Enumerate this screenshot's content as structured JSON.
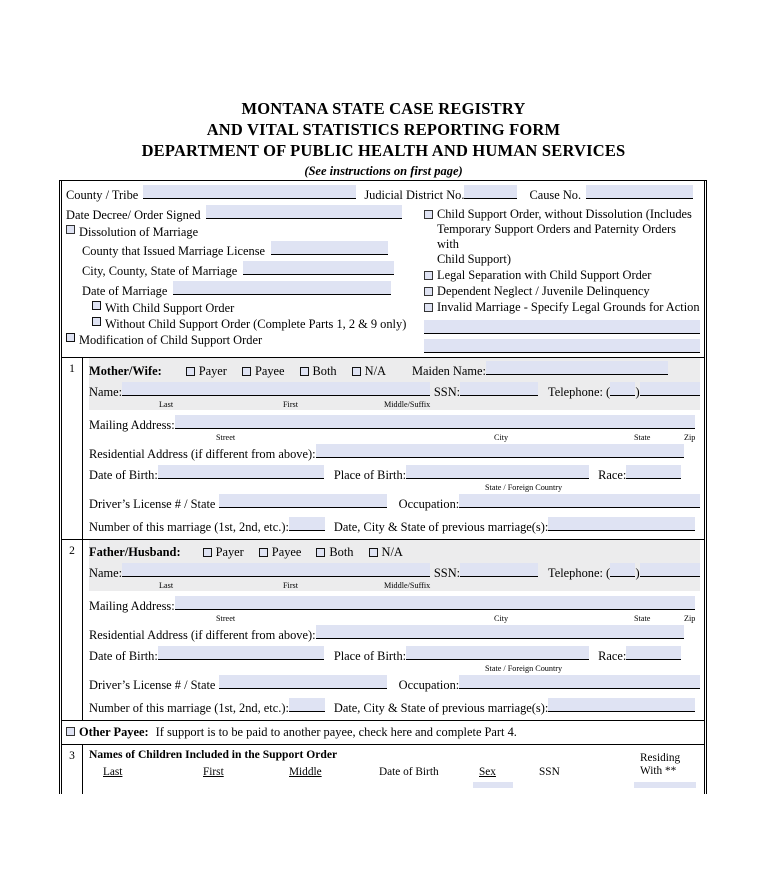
{
  "title": {
    "line1": "MONTANA STATE CASE REGISTRY",
    "line2": "AND VITAL STATISTICS REPORTING FORM",
    "line3": "DEPARTMENT OF PUBLIC HEALTH AND HUMAN SERVICES",
    "subtitle": "(See instructions on first page)"
  },
  "header": {
    "county_tribe_label": "County / Tribe",
    "judicial_district_label": "Judicial District No.",
    "cause_no_label": "Cause No.",
    "date_decree_label": "Date Decree/ Order Signed",
    "dissolution_label": "Dissolution of Marriage",
    "county_license_label": "County that Issued Marriage License",
    "city_county_state_label": "City, County, State of Marriage",
    "date_of_marriage_label": "Date of Marriage",
    "with_child_support_label": "With Child Support Order",
    "without_child_support_label": "Without Child Support Order (Complete Parts 1, 2 & 9 only)",
    "modification_label": "Modification of Child Support Order",
    "child_support_no_dissolution_line1": "Child Support Order, without Dissolution  (Includes",
    "child_support_no_dissolution_line2": "Temporary Support Orders and Paternity Orders with",
    "child_support_no_dissolution_line3": "Child Support)",
    "legal_separation_label": "Legal Separation with Child Support Order",
    "dependent_neglect_label": "Dependent Neglect / Juvenile Delinquency",
    "invalid_marriage_label": "Invalid Marriage  - Specify Legal Grounds for Action"
  },
  "part1": {
    "number": "1",
    "title": "Mother/Wife:",
    "options": [
      "Payer",
      "Payee",
      "Both",
      "N/A"
    ],
    "maiden_name_label": "Maiden Name:",
    "name_label": "Name:",
    "ssn_label": "SSN:",
    "telephone_label": "Telephone:  (",
    "telephone_close": ")",
    "cap_last": "Last",
    "cap_first": "First",
    "cap_middle": "Middle/Suffix",
    "mailing_address_label": "Mailing Address:",
    "cap_street": "Street",
    "cap_city": "City",
    "cap_state": "State",
    "cap_zip": "Zip",
    "residential_label": "Residential Address (if different from above):",
    "dob_label": "Date of Birth:",
    "pob_label": "Place of Birth:",
    "cap_state_foreign": "State / Foreign Country",
    "race_label": "Race:",
    "dl_label": "Driver’s License # / State",
    "occupation_label": "Occupation:",
    "marriage_number_label": "Number of this marriage (1st, 2nd, etc.):",
    "prev_marriage_label": "Date, City & State of previous marriage(s):"
  },
  "part2": {
    "number": "2",
    "title": "Father/Husband:",
    "options": [
      "Payer",
      "Payee",
      "Both",
      "N/A"
    ],
    "name_label": "Name:",
    "ssn_label": "SSN:",
    "telephone_label": "Telephone:  (",
    "telephone_close": ")",
    "cap_last": "Last",
    "cap_first": "First",
    "cap_middle": "Middle/Suffix",
    "mailing_address_label": "Mailing Address:",
    "cap_street": "Street",
    "cap_city": "City",
    "cap_state": "State",
    "cap_zip": "Zip",
    "residential_label": "Residential Address (if different from above):",
    "dob_label": "Date of Birth:",
    "pob_label": "Place of Birth:",
    "cap_state_foreign": "State / Foreign Country",
    "race_label": "Race:",
    "dl_label": "Driver’s License # / State",
    "occupation_label": "Occupation:",
    "marriage_number_label": "Number of this marriage (1st, 2nd, etc.):",
    "prev_marriage_label": "Date, City & State of previous marriage(s):"
  },
  "other_payee": {
    "bold_label": "Other Payee:",
    "text": "If support is to be paid to another payee, check here and complete Part 4."
  },
  "part3": {
    "number": "3",
    "title": "Names of Children Included in the Support Order",
    "columns": [
      {
        "label": "Last",
        "underline": true
      },
      {
        "label": "First",
        "underline": true
      },
      {
        "label": "Middle",
        "underline": true
      },
      {
        "label": "Date of Birth",
        "underline": false
      },
      {
        "label": "Sex",
        "underline": true
      },
      {
        "label": "SSN",
        "underline": false
      }
    ],
    "residing_line1": "Residing",
    "residing_line2": "With **"
  },
  "colors": {
    "field_fill": "#dfe3f3",
    "section_head_fill": "#ececed",
    "border": "#000000"
  }
}
